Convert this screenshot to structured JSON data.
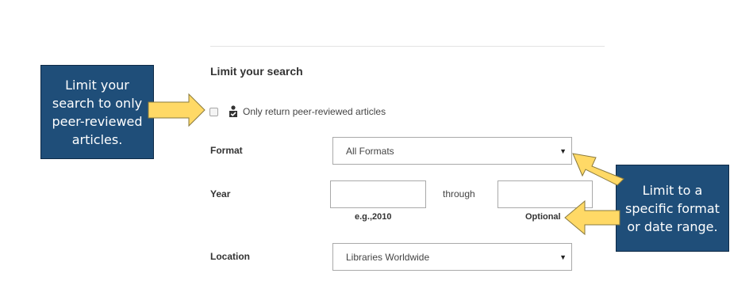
{
  "section": {
    "title": "Limit your search",
    "peer_reviewed_label": "Only return peer-reviewed articles",
    "peer_reviewed_checked": false
  },
  "format": {
    "label": "Format",
    "selected": "All Formats"
  },
  "year": {
    "label": "Year",
    "from_value": "",
    "to_value": "",
    "through_label": "through",
    "from_hint": "e.g.,2010",
    "to_hint": "Optional"
  },
  "location": {
    "label": "Location",
    "selected": "Libraries Worldwide"
  },
  "callouts": {
    "left": [
      "Limit your",
      "search to only",
      "peer-reviewed",
      "articles."
    ],
    "right": [
      "Limit to a",
      "specific format",
      "or date range."
    ]
  },
  "colors": {
    "callout_bg": "#1f4e79",
    "arrow_fill": "#ffd966",
    "arrow_stroke": "#8a7a3e"
  },
  "icons": {
    "peer_reviewed": "peer-reviewed-icon",
    "dropdown": "caret-down-icon"
  }
}
